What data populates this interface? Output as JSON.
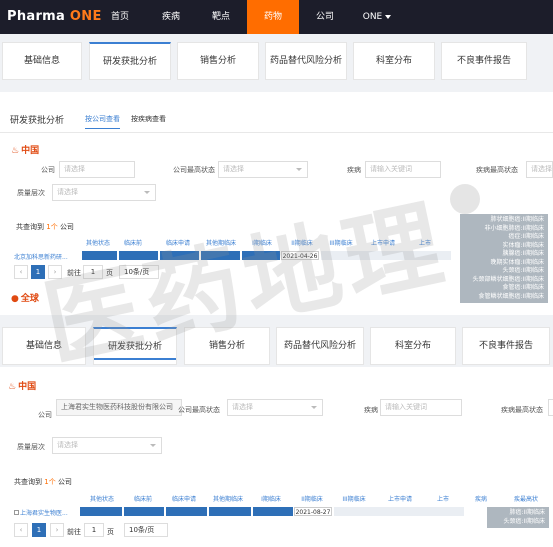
{
  "nav": {
    "logo_a": "Pharma",
    "logo_b": "ONE",
    "items": [
      "首页",
      "疾病",
      "靶点",
      "药物",
      "公司"
    ],
    "user": "ONE"
  },
  "tabs": [
    "基础信息",
    "研发获批分析",
    "销售分析",
    "药品替代风险分析",
    "科室分布",
    "不良事件报告"
  ],
  "section": {
    "title": "研发获批分析",
    "sub_company": "按公司查看",
    "sub_disease": "按疾病查看"
  },
  "top": {
    "region": "中国",
    "f_company": "公司",
    "f_company_ph": "请选择",
    "f_status": "公司最高状态",
    "f_status_ph": "请选择",
    "f_disease": "疾病",
    "f_disease_ph": "请输入关键词",
    "f_dstatus": "疾病最高状态",
    "f_dstatus_ph": "请选择",
    "f_level": "质量层次",
    "f_level_ph": "请选择",
    "count_a": "共查询到",
    "count_n": "1个",
    "count_b": "公司",
    "headers": [
      "其他状态",
      "临床前",
      "临床申请",
      "其他期临床",
      "I期临床",
      "II期临床",
      "III期临床",
      "上市申请",
      "上市"
    ],
    "row": "北京加科思新药研...",
    "date": "2021-04-26",
    "page": "1",
    "go": "前往",
    "page_in": "1",
    "page_unit": "页",
    "size": "10条/页",
    "tooltip": [
      "肺状细胞癌:II期临床",
      "非小细胞肺癌:II期临床",
      "癌症:II期临床",
      "实体瘤:II期临床",
      "胰腺癌:II期临床",
      "晚期实体瘤:II期临床",
      "头颈癌:II期临床",
      "头颈部鳞状细胞癌:II期临床",
      "食管癌:II期临床",
      "食管鳞状细胞癌:II期临床"
    ],
    "region2": "全球"
  },
  "bottom": {
    "region": "中国",
    "f_company": "公司",
    "f_company_val": "上海君实生物医药科技股份有限公司",
    "f_status": "公司最高状态",
    "f_status_ph": "请选择",
    "f_disease": "疾病",
    "f_disease_ph": "请输入关键词",
    "f_dstatus": "疾病最高状态",
    "f_level": "质量层次",
    "f_level_ph": "请选择",
    "count_a": "共查询到",
    "count_n": "1个",
    "count_b": "公司",
    "headers": [
      "其他状态",
      "临床前",
      "临床申请",
      "其他期临床",
      "I期临床",
      "II期临床",
      "III期临床",
      "上市申请",
      "上市",
      "疾病",
      "疾最高状"
    ],
    "row": "上海君实生物医...",
    "date": "2021-08-27",
    "page": "1",
    "go": "前往",
    "page_in": "1",
    "page_unit": "页",
    "size": "10条/页",
    "tooltip": [
      "肺癌:II期临床",
      "头颈癌:II期临床"
    ]
  },
  "watermark": "医药地理"
}
